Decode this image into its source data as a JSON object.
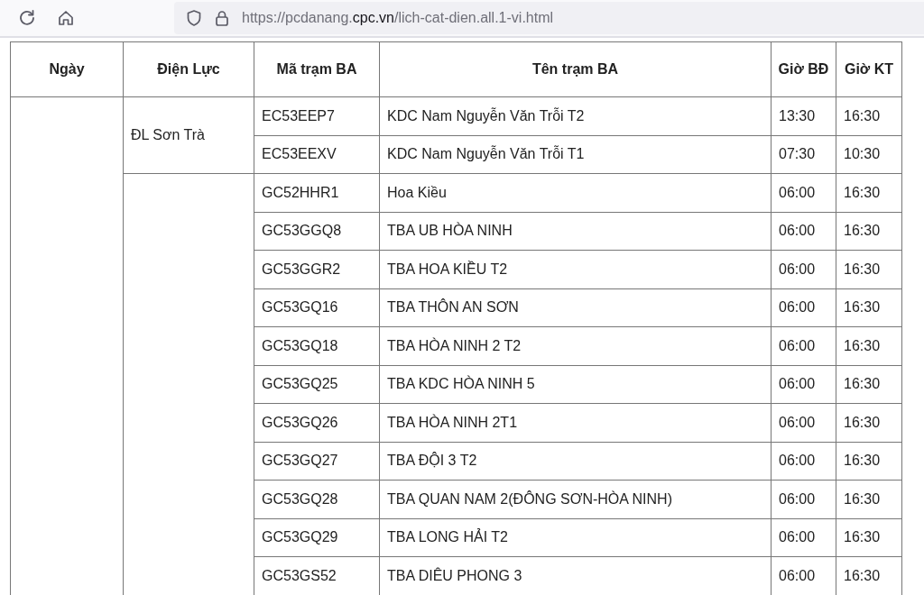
{
  "toolbar": {
    "url": {
      "prefix": "https://pcdanang.",
      "domain": "cpc.vn",
      "path": "/lich-cat-dien.all.1-vi.html"
    }
  },
  "table": {
    "columns": [
      "Ngày",
      "Điện Lực",
      "Mã trạm BA",
      "Tên trạm BA",
      "Giờ BĐ",
      "Giờ KT"
    ],
    "groups": [
      {
        "district": "ĐL Sơn Trà",
        "rows": [
          {
            "code": "EC53EEP7",
            "name": "KDC Nam Nguyễn Văn Trỗi T2",
            "start": "13:30",
            "end": "16:30"
          },
          {
            "code": "EC53EEXV",
            "name": "KDC Nam Nguyễn Văn Trỗi T1",
            "start": "07:30",
            "end": "10:30"
          }
        ]
      },
      {
        "rows": [
          {
            "code": "GC52HHR1",
            "name": "Hoa Kiều",
            "start": "06:00",
            "end": "16:30"
          },
          {
            "code": "GC53GGQ8",
            "name": "TBA UB HÒA NINH",
            "start": "06:00",
            "end": "16:30"
          },
          {
            "code": "GC53GGR2",
            "name": "TBA HOA KIỀU T2",
            "start": "06:00",
            "end": "16:30"
          },
          {
            "code": "GC53GQ16",
            "name": "TBA THÔN AN SƠN",
            "start": "06:00",
            "end": "16:30"
          },
          {
            "code": "GC53GQ18",
            "name": "TBA HÒA NINH 2 T2",
            "start": "06:00",
            "end": "16:30"
          },
          {
            "code": "GC53GQ25",
            "name": "TBA KDC HÒA NINH 5",
            "start": "06:00",
            "end": "16:30"
          },
          {
            "code": "GC53GQ26",
            "name": "TBA HÒA NINH 2T1",
            "start": "06:00",
            "end": "16:30"
          },
          {
            "code": "GC53GQ27",
            "name": "TBA ĐỘI 3 T2",
            "start": "06:00",
            "end": "16:30"
          },
          {
            "code": "GC53GQ28",
            "name": "TBA QUAN NAM 2(ĐÔNG SƠN-HÒA NINH)",
            "start": "06:00",
            "end": "16:30"
          },
          {
            "code": "GC53GQ29",
            "name": "TBA LONG HẢI T2",
            "start": "06:00",
            "end": "16:30"
          },
          {
            "code": "GC53GS52",
            "name": "TBA DIÊU PHONG 3",
            "start": "06:00",
            "end": "16:30"
          }
        ]
      }
    ]
  }
}
